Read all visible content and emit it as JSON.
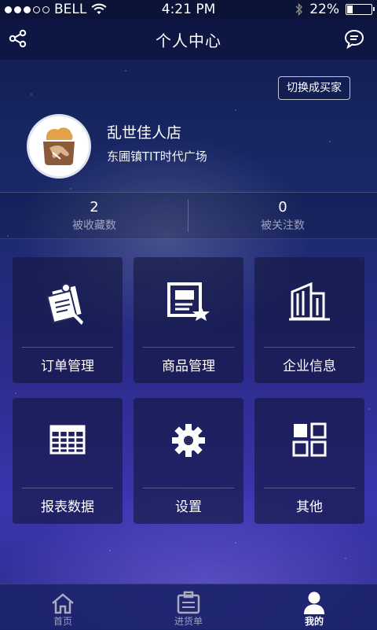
{
  "status_bar": {
    "carrier": "BELL",
    "time": "4:21 PM",
    "battery_percent": "22%",
    "battery_level": 0.22,
    "icons": [
      "signal-dots",
      "wifi-icon",
      "bluetooth-icon",
      "battery-icon"
    ]
  },
  "nav": {
    "title": "个人中心",
    "left_icon": "share-icon",
    "right_icon": "message-icon"
  },
  "profile": {
    "switch_label": "切换成买家",
    "shop_name": "乱世佳人店",
    "address": "东圃镇TIT时代广场"
  },
  "stats": [
    {
      "value": "2",
      "label": "被收藏数"
    },
    {
      "value": "0",
      "label": "被关注数"
    }
  ],
  "menu": [
    {
      "label": "订单管理",
      "icon": "order-icon"
    },
    {
      "label": "商品管理",
      "icon": "goods-icon"
    },
    {
      "label": "企业信息",
      "icon": "building-icon"
    },
    {
      "label": "报表数据",
      "icon": "table-icon"
    },
    {
      "label": "设置",
      "icon": "gear-icon"
    },
    {
      "label": "其他",
      "icon": "grid-icon"
    }
  ],
  "tabs": [
    {
      "label": "首页",
      "icon": "home-icon",
      "active": false
    },
    {
      "label": "进货单",
      "icon": "clipboard-icon",
      "active": false
    },
    {
      "label": "我的",
      "icon": "user-icon",
      "active": true
    }
  ],
  "colors": {
    "navbar": "#0e1744",
    "status_bar": "#0b1336",
    "tile_bg": "rgba(20,22,60,0.62)",
    "tabbar": "#1c246e"
  }
}
